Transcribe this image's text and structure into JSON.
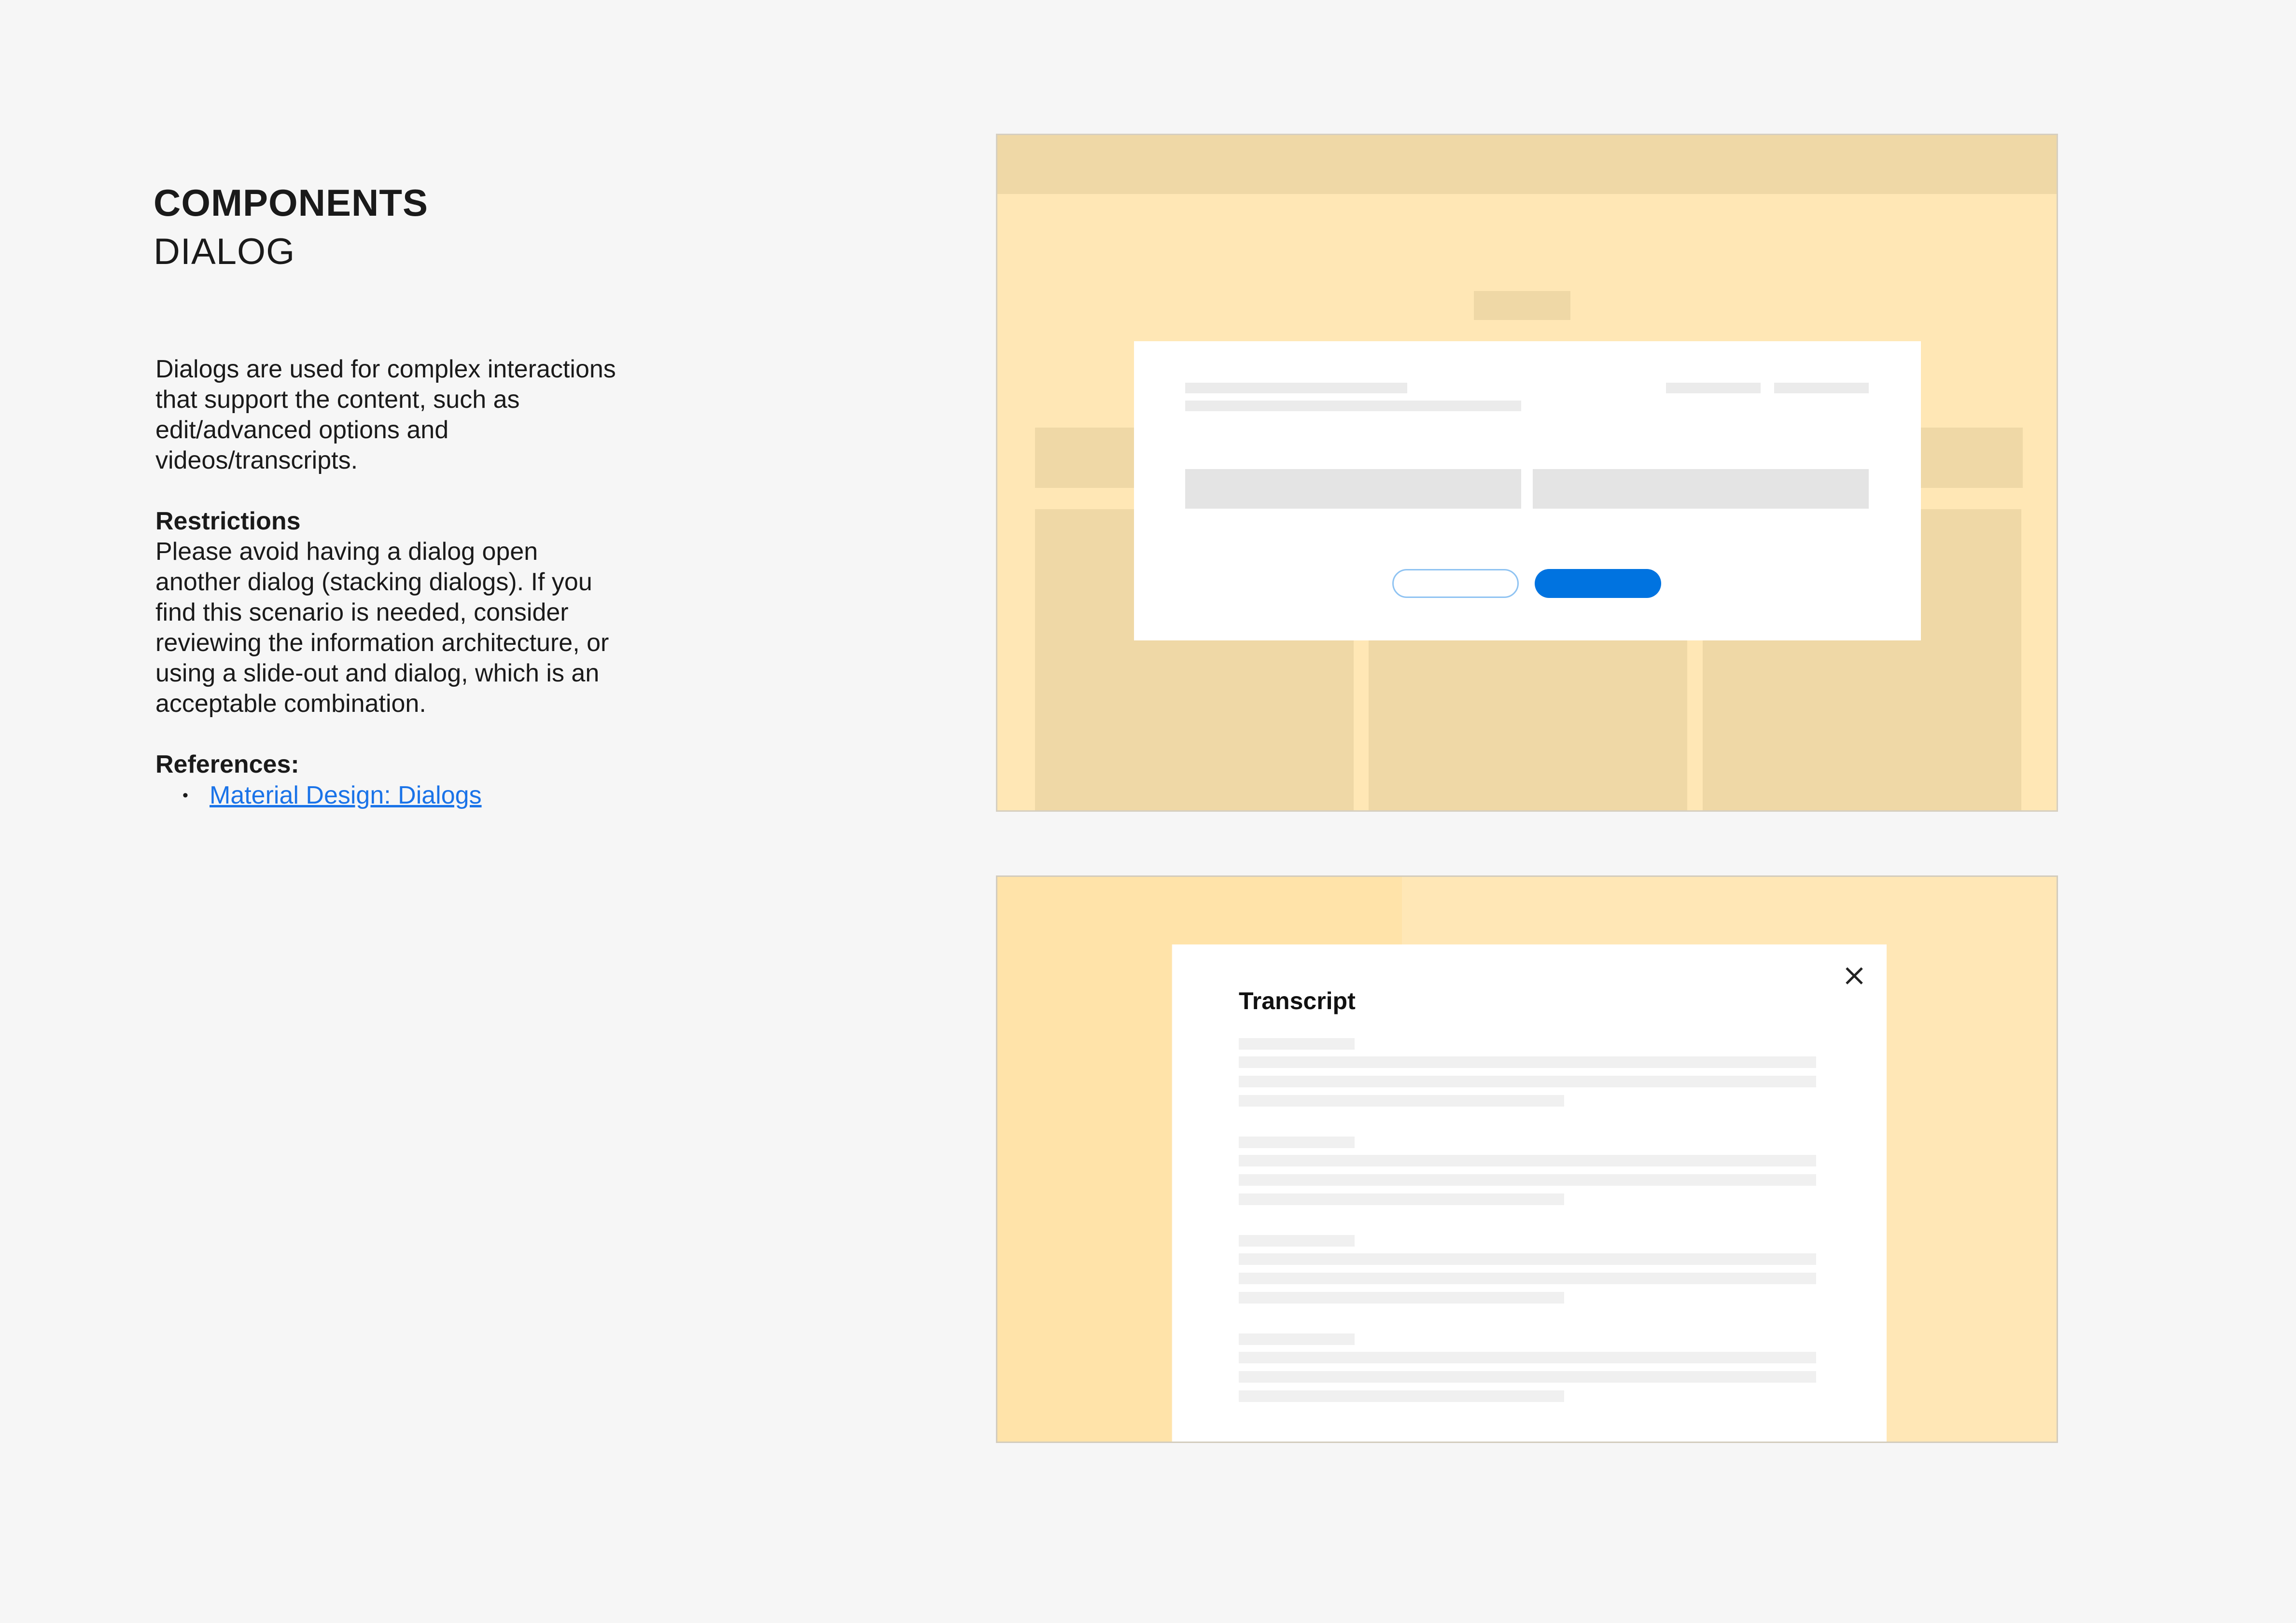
{
  "doc": {
    "title": "COMPONENTS",
    "subtitle": "DIALOG",
    "intro": "Dialogs are used for complex interactions that support the content, such as edit/advanced options and videos/transcripts.",
    "restrictions_heading": "Restrictions",
    "restrictions_body": "Please avoid having a dialog open another dialog (stacking dialogs). If you find this scenario is needed, consider reviewing the information architecture, or using a slide-out and dialog, which is an acceptable combination.",
    "references_heading": "References:",
    "references": [
      {
        "label": "Material Design: Dialogs"
      }
    ]
  },
  "example_transcript": {
    "dialog_title": "Transcript",
    "close_icon": "close-icon"
  },
  "colors": {
    "background": "#f6f6f6",
    "backdrop_yellow": "#ffe7b5",
    "backdrop_tan": "#efd8a6",
    "primary_blue": "#0073e0",
    "link_blue": "#1a73e8"
  }
}
